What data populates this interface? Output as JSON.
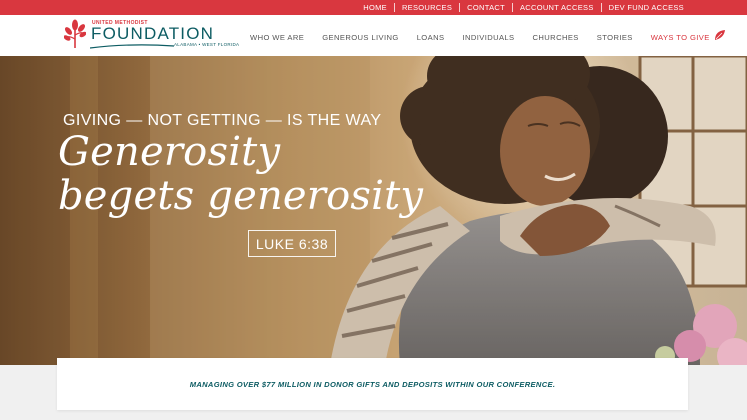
{
  "utility_nav": {
    "items": [
      "HOME",
      "RESOURCES",
      "CONTACT",
      "ACCOUNT ACCESS",
      "DEV FUND ACCESS"
    ]
  },
  "logo": {
    "small": "UNITED METHODIST",
    "main": "FOUNDATION",
    "sub": "ALABAMA • WEST FLORIDA"
  },
  "main_nav": {
    "items": [
      "WHO WE ARE",
      "GENEROUS LIVING",
      "LOANS",
      "INDIVIDUALS",
      "CHURCHES",
      "STORIES"
    ],
    "highlight": "WAYS TO GIVE"
  },
  "hero": {
    "tagline": "GIVING — NOT GETTING — IS THE WAY",
    "headline_line1": "Generosity",
    "headline_line2": "begets generosity",
    "scripture": "LUKE 6:38"
  },
  "stats": {
    "text": "MANAGING OVER $77 MILLION IN DONOR GIFTS AND DEPOSITS WITHIN OUR CONFERENCE."
  },
  "colors": {
    "brand_red": "#d9373f",
    "brand_teal": "#0d5c63",
    "nav_text": "#555555"
  },
  "icons": {
    "logo": "tree-icon",
    "ways_to_give": "leaf-icon"
  }
}
